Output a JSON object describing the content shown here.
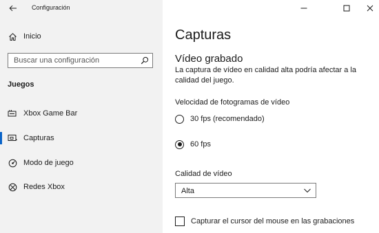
{
  "window": {
    "title": "Configuración"
  },
  "sidebar": {
    "home_label": "Inicio",
    "search_placeholder": "Buscar una configuración",
    "section_heading": "Juegos",
    "items": [
      {
        "label": "Xbox Game Bar",
        "icon": "xbox-game-bar-icon"
      },
      {
        "label": "Capturas",
        "icon": "captures-icon",
        "selected": true
      },
      {
        "label": "Modo de juego",
        "icon": "game-mode-icon"
      },
      {
        "label": "Redes Xbox",
        "icon": "xbox-icon"
      }
    ]
  },
  "main": {
    "title": "Capturas",
    "recorded_video": {
      "heading": "Vídeo grabado",
      "description": "La captura de vídeo en calidad alta podría afectar a la calidad del juego."
    },
    "frame_rate": {
      "label": "Velocidad de fotogramas de vídeo",
      "options": [
        {
          "label": "30 fps (recomendado)",
          "checked": false
        },
        {
          "label": "60 fps",
          "checked": true
        }
      ]
    },
    "quality": {
      "label": "Calidad de vídeo",
      "selected": "Alta"
    },
    "capture_cursor": {
      "label": "Capturar el cursor del mouse en las grabaciones",
      "checked": false
    }
  },
  "colors": {
    "accent": "#0a64c8",
    "sidebar_bg": "#f2f2f2"
  }
}
